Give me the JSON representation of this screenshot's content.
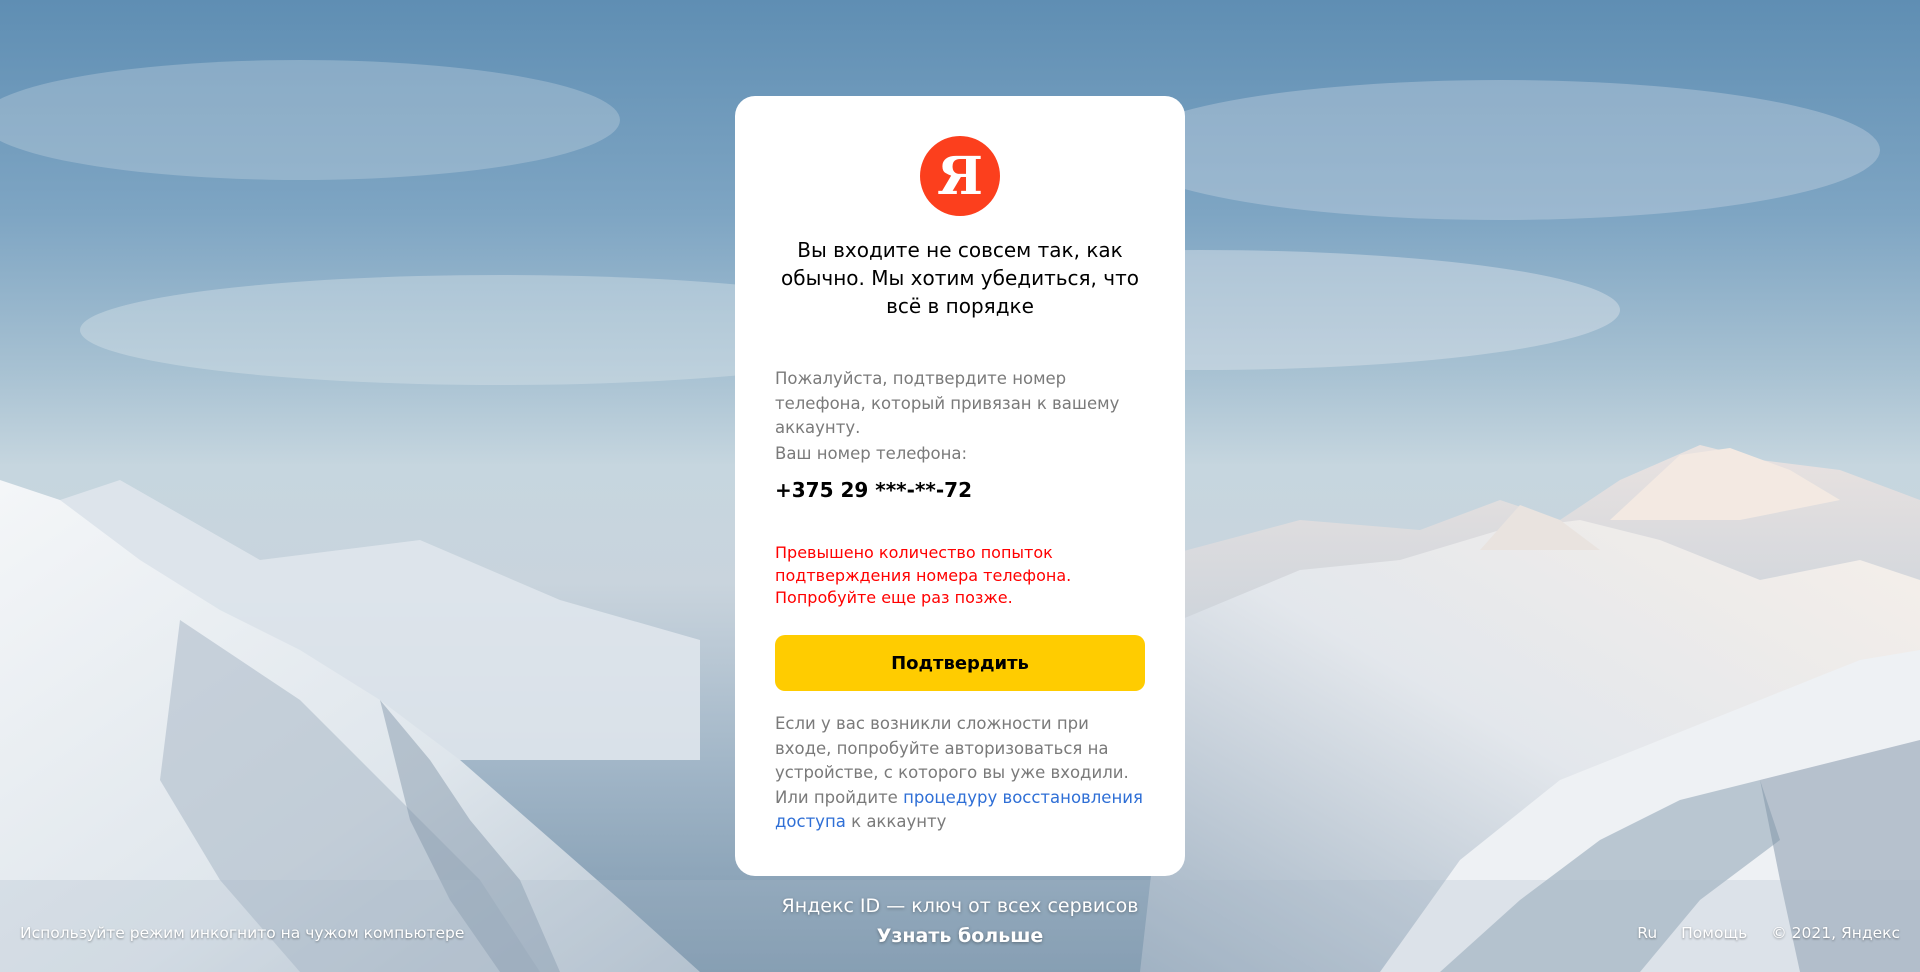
{
  "card": {
    "logo_letter": "Я",
    "title": "Вы входите не совсем так, как обычно. Мы хотим убедиться, что всё в порядке",
    "description": "Пожалуйста, подтвердите номер телефона, который привязан к вашему аккаунту.",
    "phone_label": "Ваш номер телефона:",
    "phone_number": "+375 29 ***-**-72",
    "error_message": "Превышено количество попыток подтверждения номера телефона. Попробуйте еще раз позже.",
    "confirm_button": "Подтвердить",
    "help_text_before": "Если у вас возникли сложности при входе, попробуйте авторизоваться на устройстве, с которого вы уже входили. Или пройдите ",
    "help_link": "процедуру восстановления доступа",
    "help_text_after": " к аккаунту"
  },
  "promo": {
    "text": "Яндекс ID — ключ от всех сервисов",
    "link": "Узнать больше"
  },
  "footer": {
    "incognito_hint": "Используйте режим инкогнито на чужом компьютере",
    "language": "Ru",
    "help": "Помощь",
    "copyright": "© 2021, Яндекс"
  },
  "colors": {
    "brand_red": "#fc3f1d",
    "button_yellow": "#ffcc00",
    "error_red": "#ff0000",
    "link_blue": "#2f6fd6"
  }
}
